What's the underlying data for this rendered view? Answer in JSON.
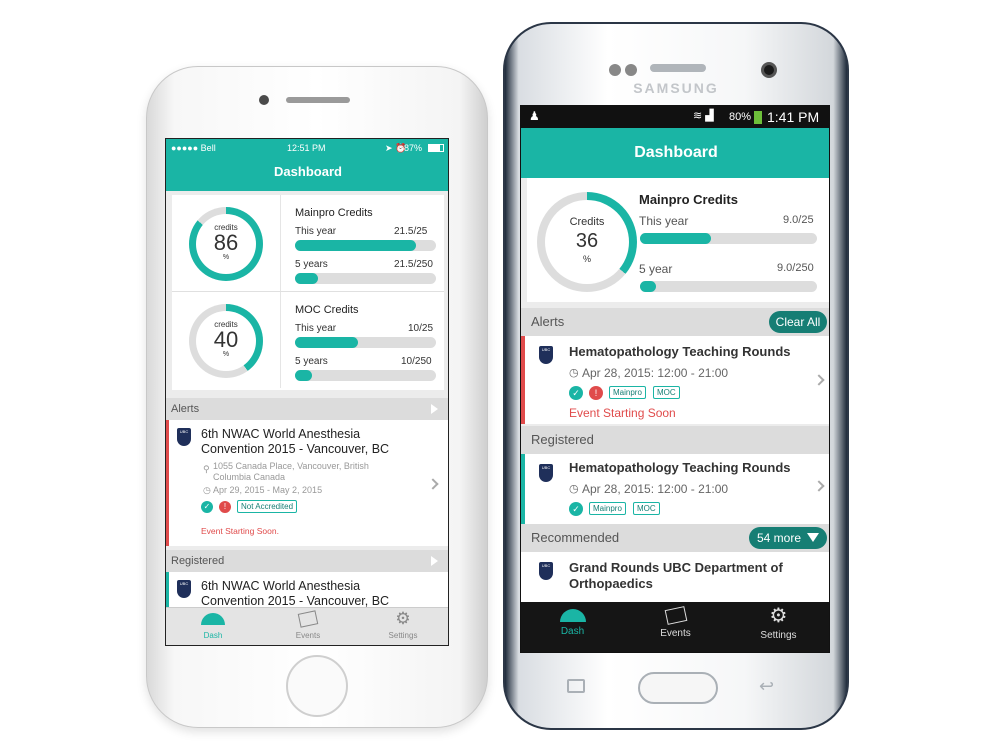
{
  "colors": {
    "accent": "#1ab5a5",
    "dark_accent": "#167e74",
    "alert": "#e04b4b"
  },
  "iphone": {
    "status": {
      "carrier": "●●●●● Bell",
      "time": "12:51 PM",
      "battery": "87%"
    },
    "title": "Dashboard",
    "mainpro": {
      "ring_top": "credits",
      "ring_value": "86",
      "ring_unit": "%",
      "ring_fraction": 0.86,
      "title": "Mainpro Credits",
      "row1_label": "This year",
      "row1_value": "21.5/25",
      "row1_fraction": 0.86,
      "row2_label": "5 years",
      "row2_value": "21.5/250",
      "row2_fraction": 0.086
    },
    "moc": {
      "ring_top": "credits",
      "ring_value": "40",
      "ring_unit": "%",
      "ring_fraction": 0.4,
      "title": "MOC Credits",
      "row1_label": "This year",
      "row1_value": "10/25",
      "row1_fraction": 0.4,
      "row2_label": "5 years",
      "row2_value": "10/250",
      "row2_fraction": 0.04
    },
    "alerts_label": "Alerts",
    "alert_event": {
      "title": "6th NWAC World Anesthesia Convention 2015 - Vancouver, BC",
      "location": "1055 Canada Place, Vancouver, British Columbia Canada",
      "dates": "Apr 29, 2015 - May 2, 2015",
      "badge": "Not Accredited",
      "warning": "Event Starting Soon."
    },
    "registered_label": "Registered",
    "registered_event": {
      "title": "6th NWAC World Anesthesia Convention 2015 - Vancouver, BC"
    },
    "tabs": {
      "dash": "Dash",
      "events": "Events",
      "settings": "Settings"
    }
  },
  "samsung": {
    "brand": "SAMSUNG",
    "status": {
      "battery": "80%",
      "time": "1:41 PM"
    },
    "title": "Dashboard",
    "mainpro": {
      "ring_top": "Credits",
      "ring_value": "36",
      "ring_unit": "%",
      "ring_fraction": 0.36,
      "title": "Mainpro Credits",
      "row1_label": "This year",
      "row1_value": "9.0/25",
      "row1_fraction": 0.36,
      "row2_label": "5 year",
      "row2_value": "9.0/250",
      "row2_fraction": 0.036
    },
    "alerts_label": "Alerts",
    "clear_all": "Clear All",
    "alert_event": {
      "title": "Hematopathology Teaching Rounds",
      "time": "Apr 28, 2015: 12:00 - 21:00",
      "tags": [
        "Mainpro",
        "MOC"
      ],
      "warning": "Event Starting Soon"
    },
    "registered_label": "Registered",
    "registered_event": {
      "title": "Hematopathology Teaching Rounds",
      "time": "Apr 28, 2015: 12:00 - 21:00",
      "tags": [
        "Mainpro",
        "MOC"
      ]
    },
    "recommended_label": "Recommended",
    "more_label": "54 more",
    "recommended_event": {
      "title": "Grand Rounds UBC Department of Orthopaedics"
    },
    "tabs": {
      "dash": "Dash",
      "events": "Events",
      "settings": "Settings"
    }
  }
}
